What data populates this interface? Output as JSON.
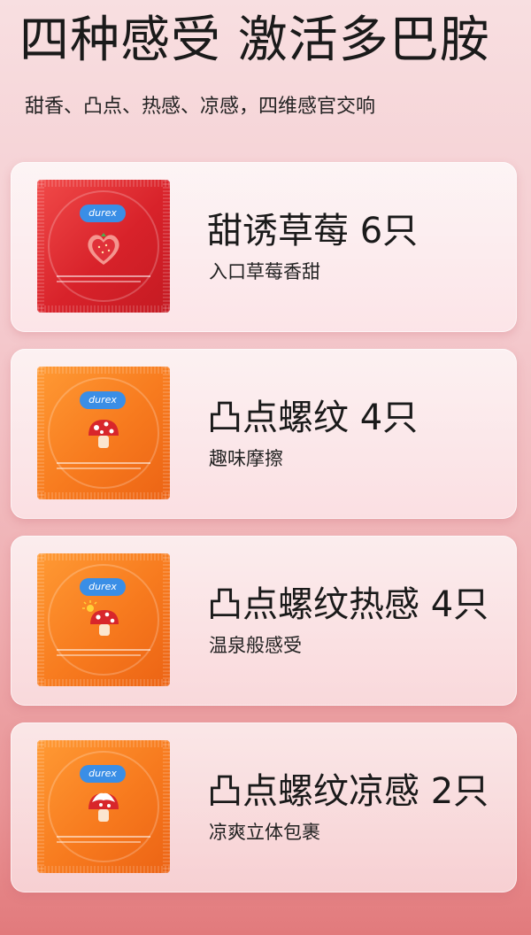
{
  "header": {
    "title": "四种感受 激活多巴胺",
    "subtitle": "甜香、凸点、热感、凉感，四维感官交响"
  },
  "products": [
    {
      "name": "甜诱草莓 6只",
      "desc": "入口草莓香甜",
      "pack_color": "red",
      "art": "strawberry-heart-icon"
    },
    {
      "name": "凸点螺纹 4只",
      "desc": "趣味摩擦",
      "pack_color": "orange",
      "art": "mushroom-icon"
    },
    {
      "name": "凸点螺纹热感 4只",
      "desc": "温泉般感受",
      "pack_color": "orange",
      "art": "mushroom-sun-icon"
    },
    {
      "name": "凸点螺纹凉感 2只",
      "desc": "凉爽立体包裹",
      "pack_color": "orange",
      "art": "mushroom-snow-icon"
    }
  ],
  "pack_brand": "durex",
  "colors": {
    "pack_red": "#d8222a",
    "pack_orange": "#f77a1e",
    "brand_blue": "#3a8ee6"
  }
}
